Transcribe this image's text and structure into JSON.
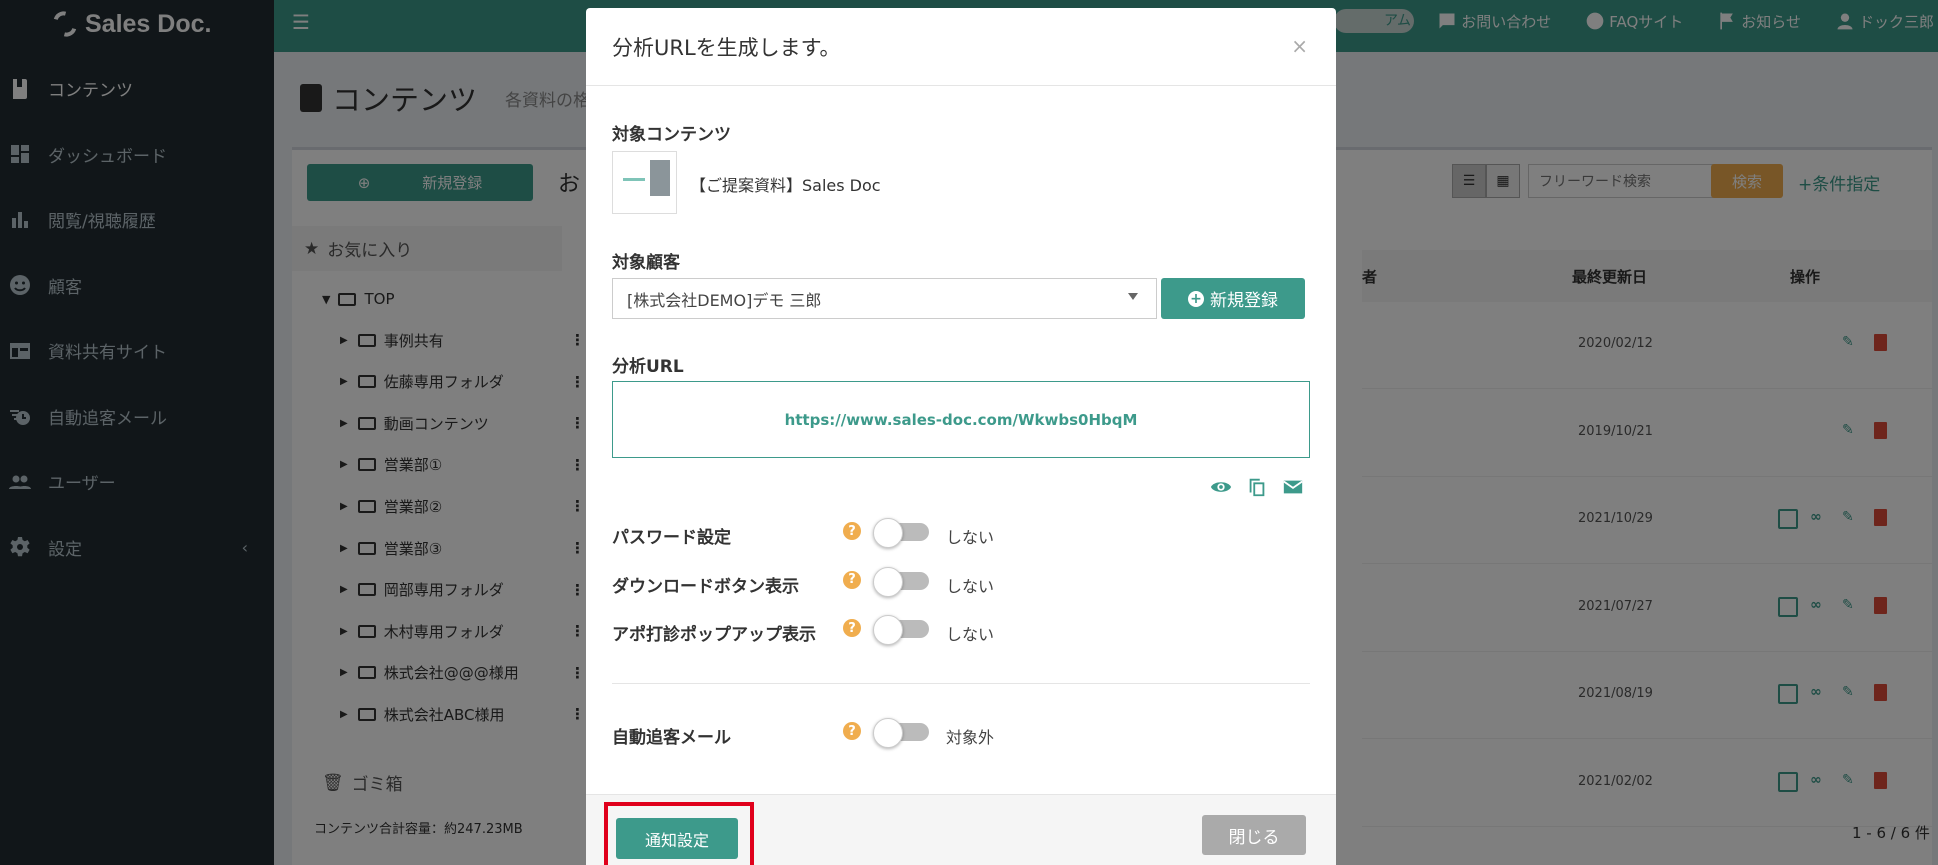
{
  "sidebar": {
    "logo": "Sales Doc.",
    "items": [
      {
        "label": "コンテンツ",
        "icon": "document-icon"
      },
      {
        "label": "ダッシュボード",
        "icon": "dashboard-icon"
      },
      {
        "label": "閲覧/視聴履歴",
        "icon": "bar-chart-icon"
      },
      {
        "label": "顧客",
        "icon": "customer-icon"
      },
      {
        "label": "資料共有サイト",
        "icon": "site-icon"
      },
      {
        "label": "自動追客メール",
        "icon": "auto-mail-icon"
      },
      {
        "label": "ユーザー",
        "icon": "users-icon"
      },
      {
        "label": "設定",
        "icon": "gear-icon"
      }
    ]
  },
  "header": {
    "pill": "アム",
    "links": [
      "お問い合わせ",
      "FAQサイト",
      "お知らせ",
      "ドック三郎"
    ]
  },
  "page": {
    "title": "コンテンツ",
    "subtitle": "各資料の格",
    "new_button": "新規登録",
    "section_title": "お",
    "favorites": "お気に入り",
    "trash": "ゴミ箱",
    "total_capacity": "コンテンツ合計容量：約247.23MB",
    "search_placeholder": "フリーワード検索",
    "search_button": "検索",
    "filter_button": "+条件指定",
    "pagination": "1 - 6 / 6 件"
  },
  "tree": {
    "root": "TOP",
    "folders": [
      "事例共有",
      "佐藤専用フォルダ",
      "動画コンテンツ",
      "営業部①",
      "営業部②",
      "営業部③",
      "岡部専用フォルダ",
      "木村専用フォルダ",
      "株式会社@@@様用",
      "株式会社ABC様用"
    ]
  },
  "table": {
    "col_owner": "者",
    "col_updated": "最終更新日",
    "col_actions": "操作",
    "dates": [
      "2020/02/12",
      "2019/10/21",
      "2021/10/29",
      "2021/07/27",
      "2021/08/19",
      "2021/02/02"
    ]
  },
  "modal": {
    "title": "分析URLを生成します。",
    "close_x": "×",
    "target_content_label": "対象コンテンツ",
    "content_name": "【ご提案資料】Sales Doc",
    "target_customer_label": "対象顧客",
    "customer_value": "[株式会社DEMO]デモ 三郎",
    "new_customer_button": "新規登録",
    "url_label": "分析URL",
    "url_value": "https://www.sales-doc.com/Wkwbs0HbqM",
    "options": [
      {
        "label": "パスワード設定",
        "value": "しない"
      },
      {
        "label": "ダウンロードボタン表示",
        "value": "しない"
      },
      {
        "label": "アポ打診ポップアップ表示",
        "value": "しない"
      }
    ],
    "auto_mail_label": "自動追客メール",
    "auto_mail_value": "対象外",
    "notify_button": "通知設定",
    "close_button": "閉じる"
  },
  "colors": {
    "accent": "#3d9a8b",
    "sidebar_bg": "#222d32",
    "help": "#f0ad4e",
    "highlight": "#e0001b",
    "delete": "#dd4b39"
  }
}
